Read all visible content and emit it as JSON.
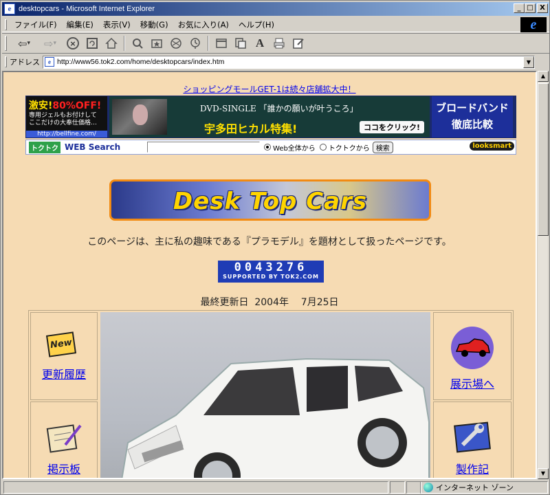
{
  "window": {
    "title": "desktopcars - Microsoft Internet Explorer",
    "controls": [
      "_",
      "□",
      "X"
    ]
  },
  "menu": [
    "ファイル(F)",
    "編集(E)",
    "表示(V)",
    "移動(G)",
    "お気に入り(A)",
    "ヘルプ(H)"
  ],
  "toolbar": {
    "back": "⇦",
    "forward": "⇨",
    "dropdown": "▾"
  },
  "address": {
    "label": "アドレス",
    "url": "http://www56.tok2.com/home/desktopcars/index.htm"
  },
  "page": {
    "promo_link": "ショッピングモールGET-1は続々店舗拡大中！",
    "ads": {
      "left": {
        "headline_a": "激安!",
        "headline_b": "80%OFF!",
        "body": "専用ジェルもお付けして ここだけの大奉仕価格…",
        "url": "http://bellfine.com/"
      },
      "center": {
        "line1": "DVD-SINGLE 「誰かの願いが叶うころ」",
        "line2": "宇多田ヒカル特集!",
        "cta": "ココをクリック!"
      },
      "right": {
        "line1": "ブロードバンド",
        "line2": "徹底比較"
      }
    },
    "search": {
      "logo": "トクトク",
      "title": "WEB Search",
      "option_web": "Web全体から",
      "option_site": "トクトクから",
      "button": "検索",
      "powered": "looksmart"
    },
    "banner_text": "Desk Top Cars",
    "intro": "このページは、主に私の趣味である『プラモデル』を題材として扱ったページです。",
    "counter": {
      "digits": "0043276",
      "supported": "SUPPORTED BY TOK2.COM"
    },
    "updated": "最終更新日  2004年    7月25日",
    "nav": {
      "history": "更新履歴",
      "showroom": "展示場へ",
      "bbs": "掲示板",
      "making": "製作記"
    },
    "icon_new_text": "New"
  },
  "status": {
    "zone": "インターネット ゾーン"
  },
  "colors": {
    "page_bg": "#f6dbb3",
    "link": "#0000ee",
    "titlebar": "#0a246a",
    "banner_text": "#ffd400"
  }
}
